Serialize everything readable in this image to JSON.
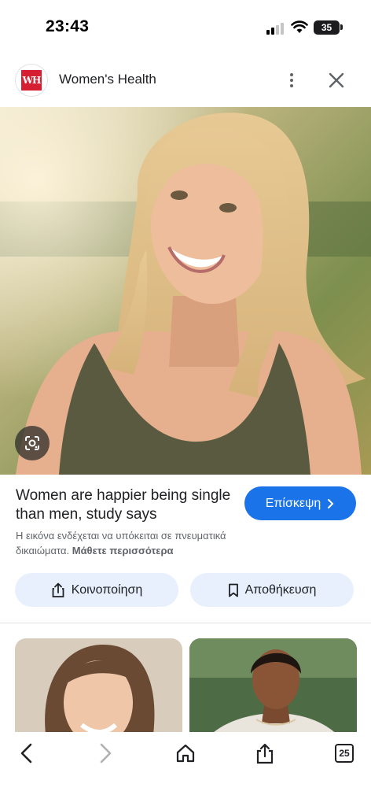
{
  "status_bar": {
    "time": "23:43",
    "battery": "35"
  },
  "header": {
    "site_name": "Women's Health",
    "logo_text": "WH"
  },
  "article": {
    "title": "Women are happier being single than men, study says",
    "visit_label": "Επίσκεψη",
    "copyright_notice": "Η εικόνα ενδέχεται να υπόκειται σε πνευματικά δικαιώματα.",
    "learn_more": "Μάθετε περισσότερα"
  },
  "actions": {
    "share_label": "Κοινοποίηση",
    "save_label": "Αποθήκευση"
  },
  "bottom_bar": {
    "tab_count": "25"
  },
  "icons": [
    "more-vert-icon",
    "close-icon",
    "lens-icon",
    "chevron-right-icon",
    "share-icon",
    "bookmark-icon",
    "back-icon",
    "forward-icon",
    "home-icon",
    "share-icon",
    "tabs-icon"
  ],
  "colors": {
    "accent": "#1a73e8",
    "pill_bg": "#e8f0fe",
    "logo_red": "#d71f33"
  }
}
